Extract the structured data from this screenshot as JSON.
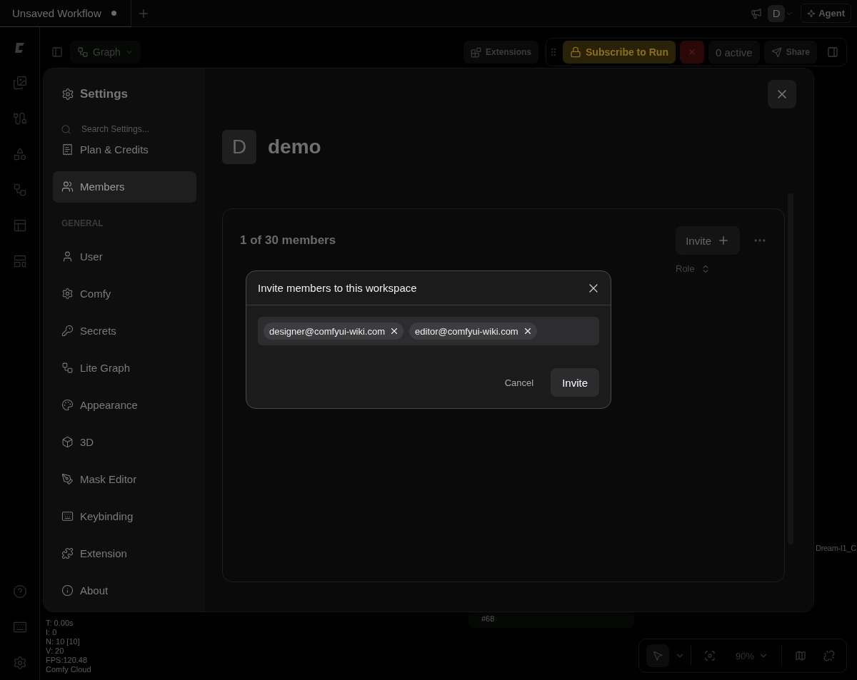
{
  "tab": {
    "title": "Unsaved Workflow",
    "unsaved": true
  },
  "top_bar": {
    "avatar": "D",
    "agent": "Agent"
  },
  "toolbar": {
    "view": "Graph",
    "extensions": "Extensions",
    "subscribe": "Subscribe to Run",
    "active": "0 active",
    "share": "Share"
  },
  "settings": {
    "title": "Settings",
    "search": {
      "placeholder": "Search Settings..."
    },
    "nav": [
      {
        "label": "Plan & Credits",
        "selected": false
      },
      {
        "label": "Members",
        "selected": true
      }
    ],
    "section": "GENERAL",
    "general": [
      {
        "label": "User",
        "selected": false
      },
      {
        "label": "Comfy",
        "selected": false
      },
      {
        "label": "Secrets",
        "selected": false
      },
      {
        "label": "Lite Graph",
        "selected": false
      },
      {
        "label": "Appearance",
        "selected": false
      },
      {
        "label": "3D",
        "selected": false
      },
      {
        "label": "Mask Editor",
        "selected": false
      },
      {
        "label": "Keybinding",
        "selected": false
      },
      {
        "label": "Extension",
        "selected": false
      },
      {
        "label": "About",
        "selected": false
      }
    ]
  },
  "workspace": {
    "avatar": "D",
    "name": "demo"
  },
  "members": {
    "count": "1 of 30 members",
    "invite": "Invite",
    "column": "Role"
  },
  "dialog": {
    "title": "Invite members to this workspace",
    "emails": [
      "designer@comfyui-wiki.com",
      "editor@comfyui-wiki.com"
    ],
    "cancel": "Cancel",
    "invite": "Invite"
  },
  "stats": [
    "T: 0.00s",
    "I: 0",
    "N: 10 [10]",
    "V: 20",
    "FPS:120.48",
    "Comfy Cloud"
  ],
  "canvas": {
    "node_id": "#68",
    "node_label": "Dream-I1_C"
  },
  "zoom": "90%"
}
